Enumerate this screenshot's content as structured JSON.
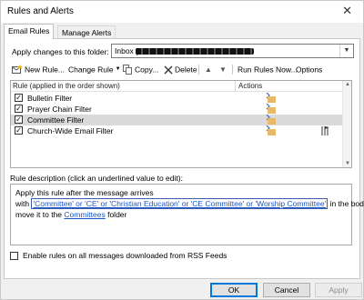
{
  "window": {
    "title": "Rules and Alerts",
    "close_glyph": "✕"
  },
  "tabs": [
    {
      "label": "Email Rules",
      "active": true
    },
    {
      "label": "Manage Alerts",
      "active": false
    }
  ],
  "apply_to": {
    "label": "Apply changes to this folder:",
    "value_prefix": "Inbox ["
  },
  "toolbar": {
    "new_rule": "New Rule...",
    "change_rule": "Change Rule",
    "copy": "Copy...",
    "delete": "Delete",
    "run_rules": "Run Rules Now...",
    "options": "Options"
  },
  "rules_table": {
    "header_rule": "Rule (applied in the order shown)",
    "header_actions": "Actions",
    "rows": [
      {
        "name": "Bulletin Filter",
        "checked": true,
        "selected": false,
        "extra_icon": false
      },
      {
        "name": "Prayer Chain Filter",
        "checked": true,
        "selected": false,
        "extra_icon": false
      },
      {
        "name": "Committee Filter",
        "checked": true,
        "selected": true,
        "extra_icon": false
      },
      {
        "name": "Church-Wide Email Filter",
        "checked": true,
        "selected": false,
        "extra_icon": true
      }
    ]
  },
  "description": {
    "label": "Rule description (click an underlined value to edit):",
    "line1": "Apply this rule after the message arrives",
    "line2_prefix": "with ",
    "line2_link": "'Committee' or 'CE' or 'Christian Education' or 'CE Committee' or 'Worship Committee'",
    "line2_suffix": " in the body",
    "line3_prefix": "move it to the ",
    "line3_link": "Committees",
    "line3_suffix": " folder"
  },
  "rss": {
    "label": "Enable rules on all messages downloaded from RSS Feeds",
    "checked": false
  },
  "buttons": {
    "ok": "OK",
    "cancel": "Cancel",
    "apply": "Apply"
  },
  "colors": {
    "accent": "#0078d7",
    "link": "#1a56c7",
    "selected_row": "#dadada"
  }
}
